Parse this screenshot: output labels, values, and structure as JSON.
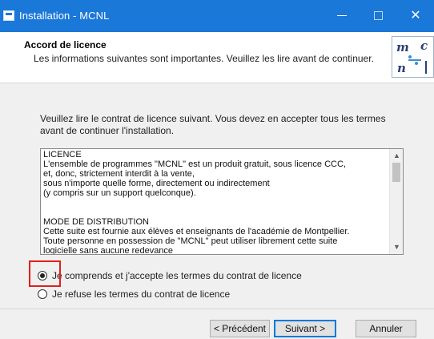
{
  "window": {
    "title": "Installation - MCNL",
    "minimize_label": "—",
    "close_label": "✕"
  },
  "header": {
    "title": "Accord de licence",
    "subtitle": "Les informations suivantes sont importantes. Veuillez les lire avant de continuer."
  },
  "body": {
    "intro": "Veuillez lire le contrat de licence suivant. Vous devez en accepter tous les termes avant de continuer l'installation.",
    "license_lines": [
      "LICENCE",
      "L'ensemble de programmes \"MCNL\" est un produit gratuit, sous licence CCC,",
      "et, donc, strictement interdit à la vente,",
      "sous n'importe quelle forme, directement ou indirectement",
      "(y compris sur un support quelconque).",
      "",
      "",
      "MODE DE DISTRIBUTION",
      "Cette suite est fournie aux élèves et enseignants de l'académie de Montpellier.",
      "Toute personne en possession de \"MCNL\" peut utiliser librement cette suite",
      "logicielle sans aucune redevance"
    ],
    "scroll_up": "▲",
    "scroll_down": "▼",
    "radio_accept": "Je comprends et j'accepte les termes du contrat de licence",
    "radio_refuse": "Je refuse les termes du contrat de licence",
    "accept_selected": true
  },
  "buttons": {
    "previous": "< Précédent",
    "next": "Suivant >",
    "cancel": "Annuler"
  },
  "colors": {
    "titlebar": "#1a78d8",
    "highlight": "#e0201c",
    "default_button_border": "#0078d7"
  },
  "icons": {
    "app": "installer-icon",
    "logo": "mcnl-logo"
  }
}
